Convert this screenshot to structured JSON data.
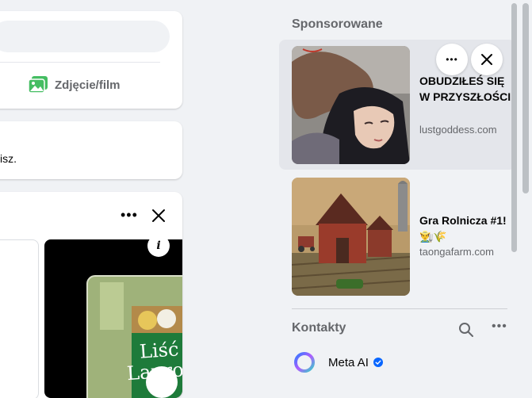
{
  "composer": {
    "photo_label": "Zdjęcie/film"
  },
  "post": {
    "snippet": "isz."
  },
  "reels": {
    "options_label": "•••",
    "info_label": "i",
    "jar_text_1": "Liść",
    "jar_text_2": "Laurow"
  },
  "sponsored": {
    "title": "Sponsorowane",
    "ads": [
      {
        "title": "OBUDZIŁEŚ SIĘ W PRZYSZŁOŚCI",
        "domain": "lustgoddess.com"
      },
      {
        "title": "Gra Rolnicza #1! 👨‍🌾🌾",
        "domain": "taongafarm.com"
      }
    ],
    "options_label": "•••"
  },
  "contacts": {
    "title": "Kontakty",
    "options_label": "•••",
    "items": [
      {
        "name": "Meta AI"
      }
    ]
  },
  "colors": {
    "accent": "#0866ff",
    "secondary_text": "#65676b",
    "page_bg": "#f0f2f5"
  }
}
